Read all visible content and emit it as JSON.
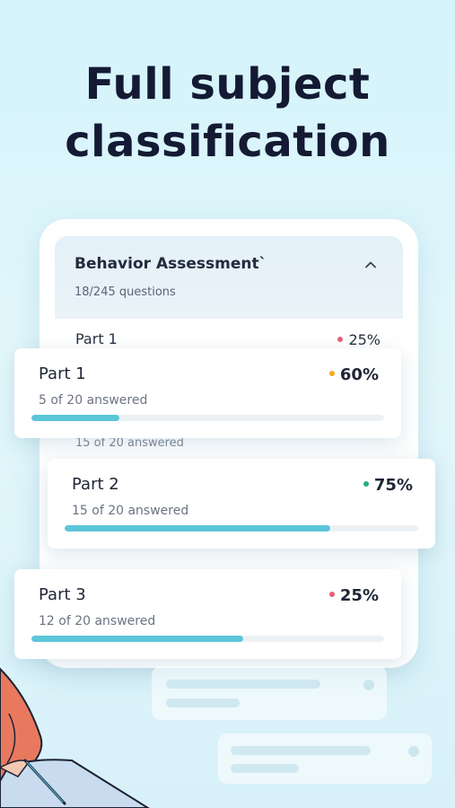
{
  "headline": {
    "line1": "Full subject",
    "line2": "classification"
  },
  "section": {
    "title": "Behavior Assessment`",
    "subtitle": "18/245 questions"
  },
  "background_rows": {
    "row1_title": "Part 1",
    "row1_pct": "25%",
    "row2_sub": "15 of 20 answered"
  },
  "cards": [
    {
      "title": "Part 1",
      "pct": "60%",
      "answered": "5 of 20 answered",
      "progress": 0.25,
      "dot_color": "#f5a623"
    },
    {
      "title": "Part 2",
      "pct": "75%",
      "answered": "15 of 20 answered",
      "progress": 0.75,
      "dot_color": "#22b07d"
    },
    {
      "title": "Part 3",
      "pct": "25%",
      "answered": "12 of 20 answered",
      "progress": 0.6,
      "dot_color": "#e5607a"
    }
  ],
  "colors": {
    "accent": "#5cc6d9",
    "background": "#d4f3fb",
    "headline": "#141a33"
  },
  "icons": {
    "collapse": "chevron-up-icon"
  }
}
